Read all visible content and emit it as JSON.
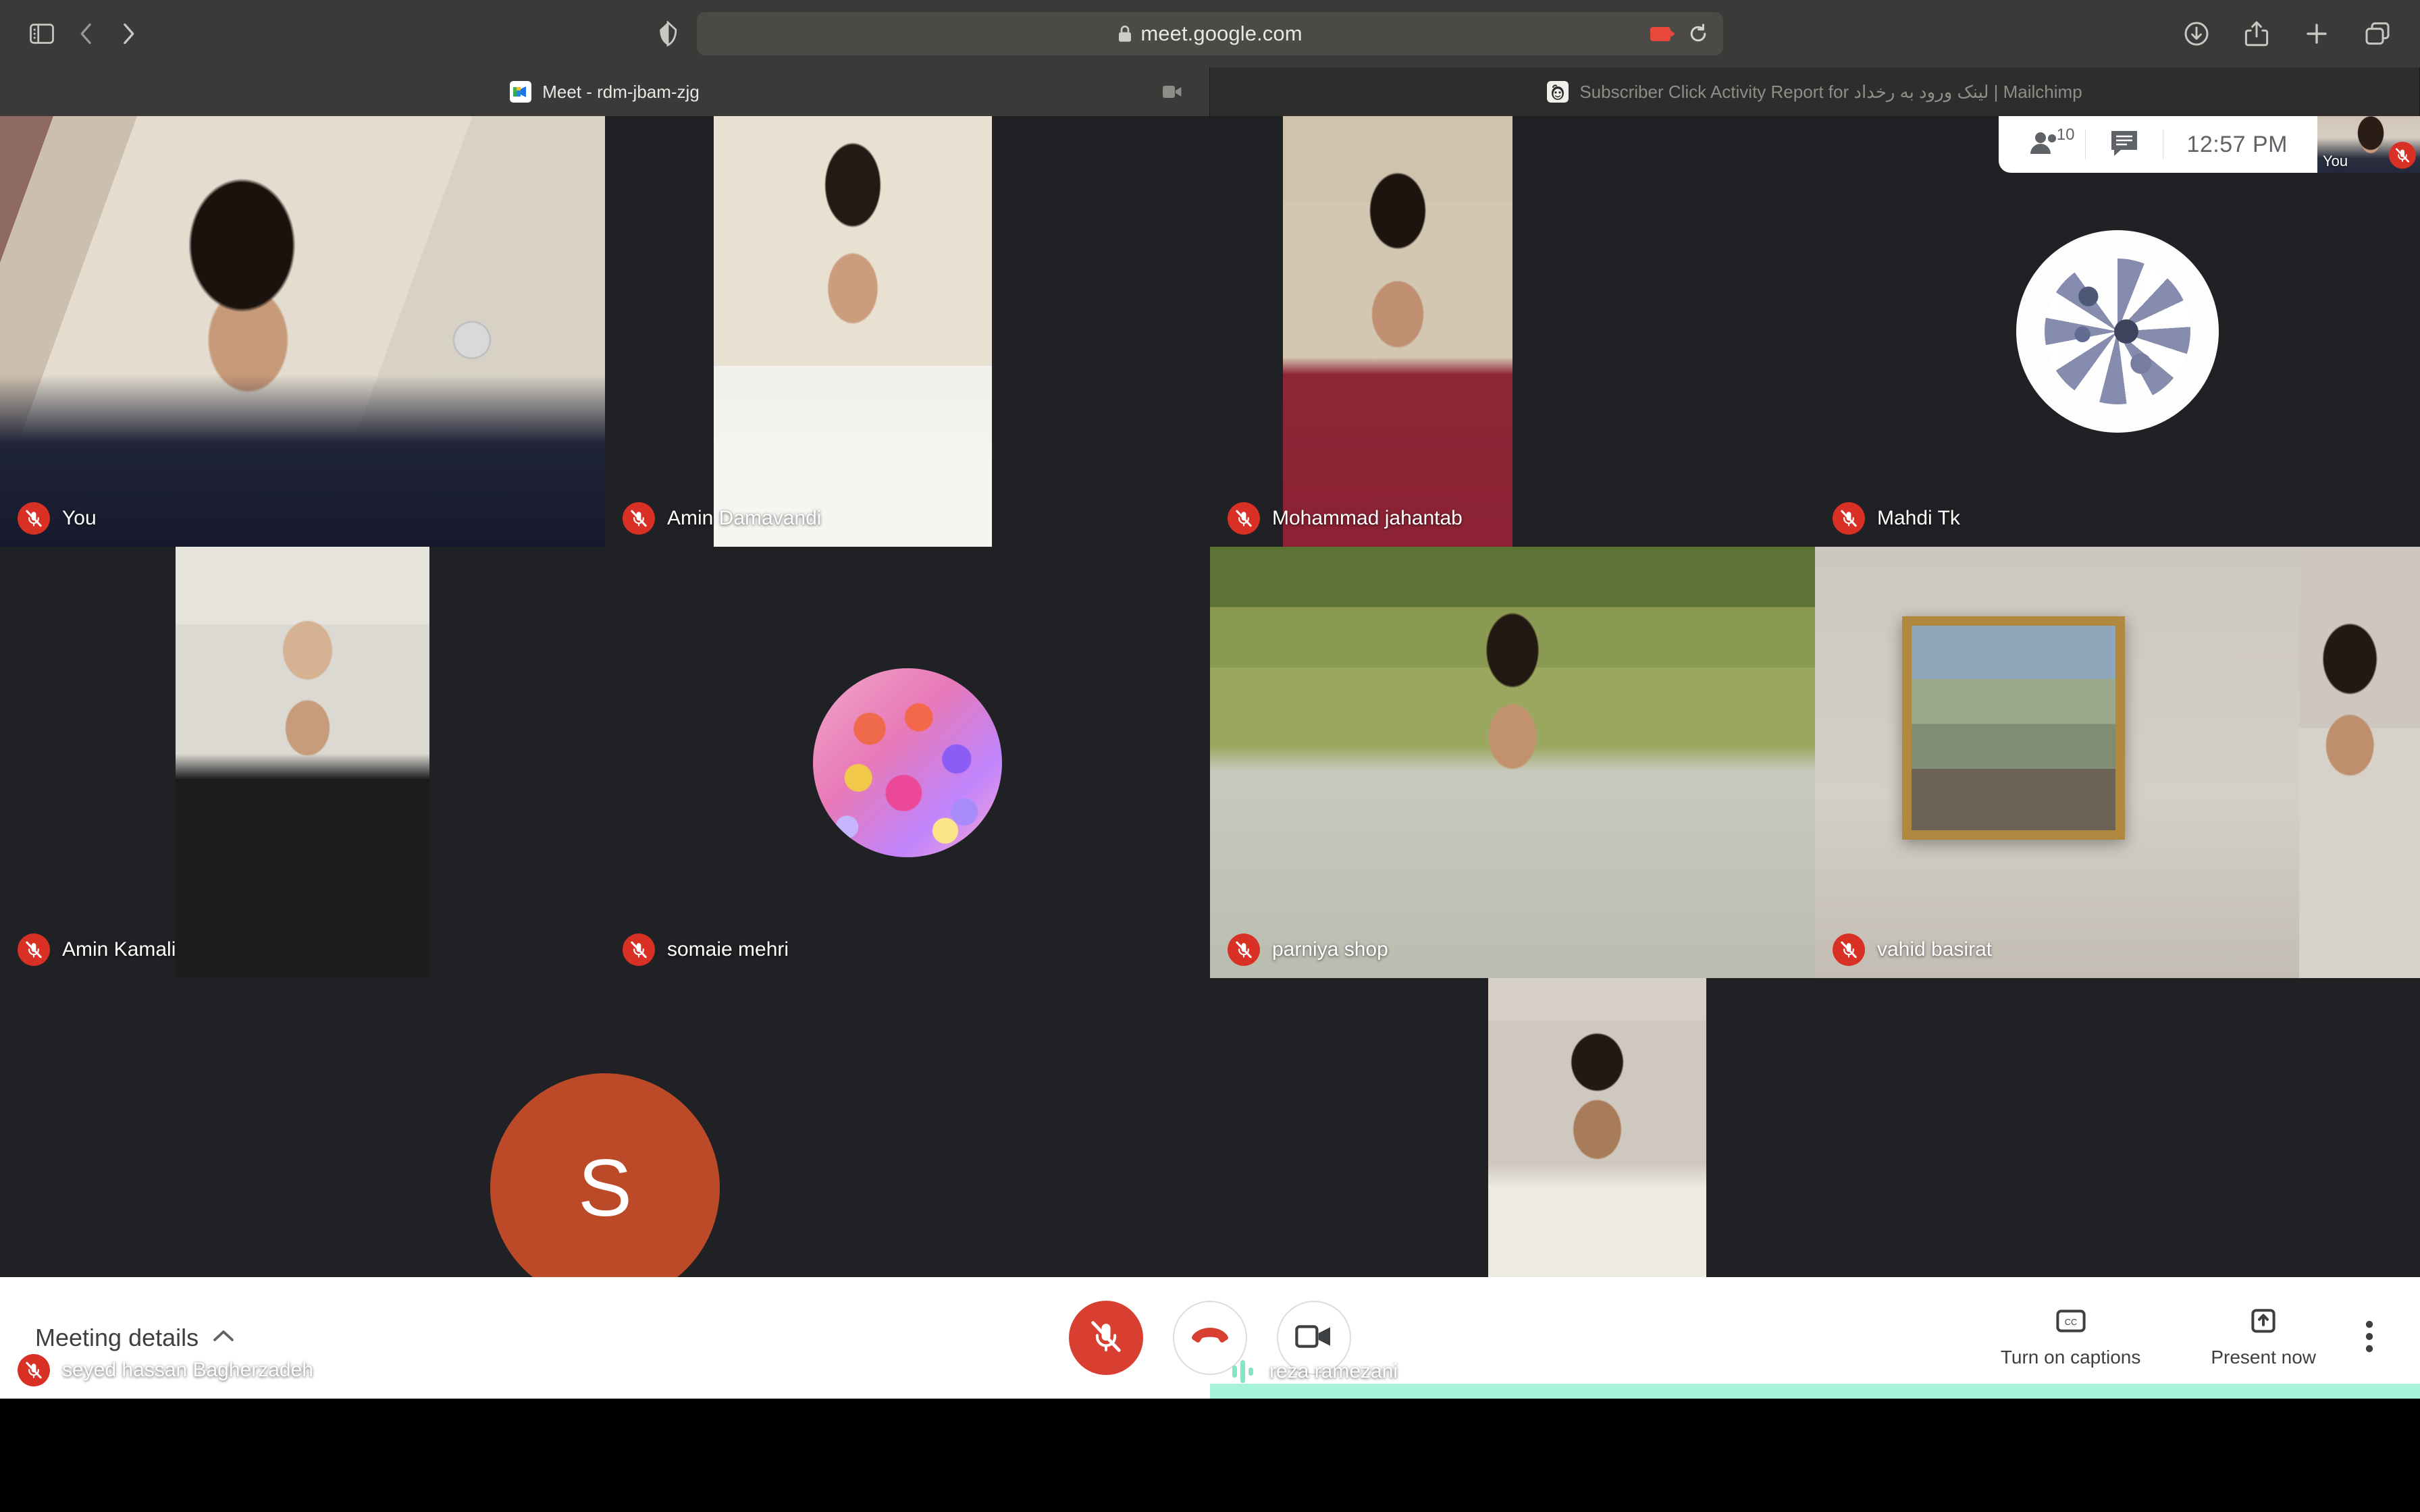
{
  "browser": {
    "url": "meet.google.com",
    "lock_icon": "lock-icon",
    "camera_recording_icon": "camera-active-icon",
    "reload_icon": "reload-icon",
    "sidebar_icon": "sidebar-toggle-icon",
    "back_icon": "chevron-left-icon",
    "forward_icon": "chevron-right-icon",
    "shield_icon": "shield-privacy-icon",
    "downloads_icon": "downloads-icon",
    "share_icon": "share-icon",
    "new_tab_icon": "plus-icon",
    "tab_overview_icon": "tab-overview-icon",
    "tabs": [
      {
        "title": "Meet - rdm-jbam-zjg",
        "favicon": "google-meet-icon",
        "active": true,
        "media_icon": "camera-icon"
      },
      {
        "title": "Subscriber Click Activity Report for لینک ورود به رخداد | Mailchimp",
        "favicon": "mailchimp-icon",
        "active": false,
        "media_icon": ""
      }
    ]
  },
  "meet": {
    "topbar": {
      "participants_icon": "people-icon",
      "participant_count": "10",
      "chat_icon": "chat-icon",
      "clock": "12:57  PM",
      "self_view_label": "You",
      "self_view_mic_icon": "mic-off-icon"
    },
    "rows": [
      {
        "height_pct": 33.6,
        "tiles": [
          {
            "name": "You",
            "muted": true,
            "width_pct": 25,
            "kind": "video",
            "video_class": "v-you",
            "video_left_pct": 0,
            "video_width_pct": 100,
            "speaking": false
          },
          {
            "name": "Amin Damavandi",
            "muted": true,
            "width_pct": 25,
            "kind": "video",
            "video_class": "v-damavandi",
            "video_left_pct": 18,
            "video_width_pct": 46,
            "speaking": false
          },
          {
            "name": "Mohammad jahantab",
            "muted": true,
            "width_pct": 25,
            "kind": "video",
            "video_class": "v-jahantab",
            "video_left_pct": 12,
            "video_width_pct": 38,
            "speaking": false
          },
          {
            "name": "Mahdi Tk",
            "muted": true,
            "width_pct": 25,
            "kind": "avatar-image",
            "avatar_class": "av-gears",
            "avatar_size_pct": 46,
            "speaking": false
          }
        ]
      },
      {
        "height_pct": 33.6,
        "tiles": [
          {
            "name": "Amin Kamali",
            "muted": true,
            "width_pct": 25,
            "kind": "video",
            "video_class": "v-kamali",
            "video_left_pct": 29,
            "video_width_pct": 42,
            "speaking": false
          },
          {
            "name": "somaie mehri",
            "muted": true,
            "width_pct": 25,
            "kind": "avatar-image",
            "avatar_class": "av-flowers",
            "avatar_size_pct": 46,
            "speaking": false
          },
          {
            "name": "parniya shop",
            "muted": true,
            "width_pct": 25,
            "kind": "video",
            "video_class": "v-parniya",
            "video_left_pct": 0,
            "video_width_pct": 100,
            "speaking": false
          },
          {
            "name": "vahid basirat",
            "muted": true,
            "width_pct": 25,
            "kind": "video-framed",
            "video_class": "v-basirat",
            "video_left_pct": 0,
            "video_width_pct": 80,
            "extra_class": "v-basirat2",
            "extra_left_pct": 80,
            "extra_width_pct": 20,
            "speaking": false
          }
        ]
      },
      {
        "height_pct": 32.8,
        "tiles": [
          {
            "name": "seyed hassan Bagherzadeh",
            "muted": true,
            "width_pct": 50,
            "kind": "avatar-initial",
            "initial": "S",
            "avatar_color": "#bc4a28",
            "avatar_size_pct": 44,
            "speaking": false
          },
          {
            "name": "reza ramezani",
            "muted": false,
            "width_pct": 50,
            "kind": "video",
            "video_class": "v-reza",
            "video_left_pct": 23,
            "video_width_pct": 18,
            "speaking": true
          }
        ]
      }
    ],
    "bottombar": {
      "meeting_details_label": "Meeting details",
      "meeting_details_chevron": "chevron-up-icon",
      "mic_button": {
        "name": "mic-off-button",
        "icon": "mic-off-icon",
        "state": "muted"
      },
      "hangup_button": {
        "name": "hang-up-button",
        "icon": "phone-hangup-icon"
      },
      "camera_button": {
        "name": "camera-button",
        "icon": "camera-icon"
      },
      "captions": {
        "label": "Turn on captions",
        "icon": "closed-captions-icon"
      },
      "present": {
        "label": "Present now",
        "icon": "present-screen-icon"
      },
      "more_options_icon": "more-vertical-icon"
    }
  },
  "colors": {
    "muted_red": "#d93025",
    "mic_button_red": "#d93f31",
    "speaking_teal": "#a7f3d8",
    "stage_bg": "#202124",
    "chrome_bg": "#3b3a38"
  }
}
